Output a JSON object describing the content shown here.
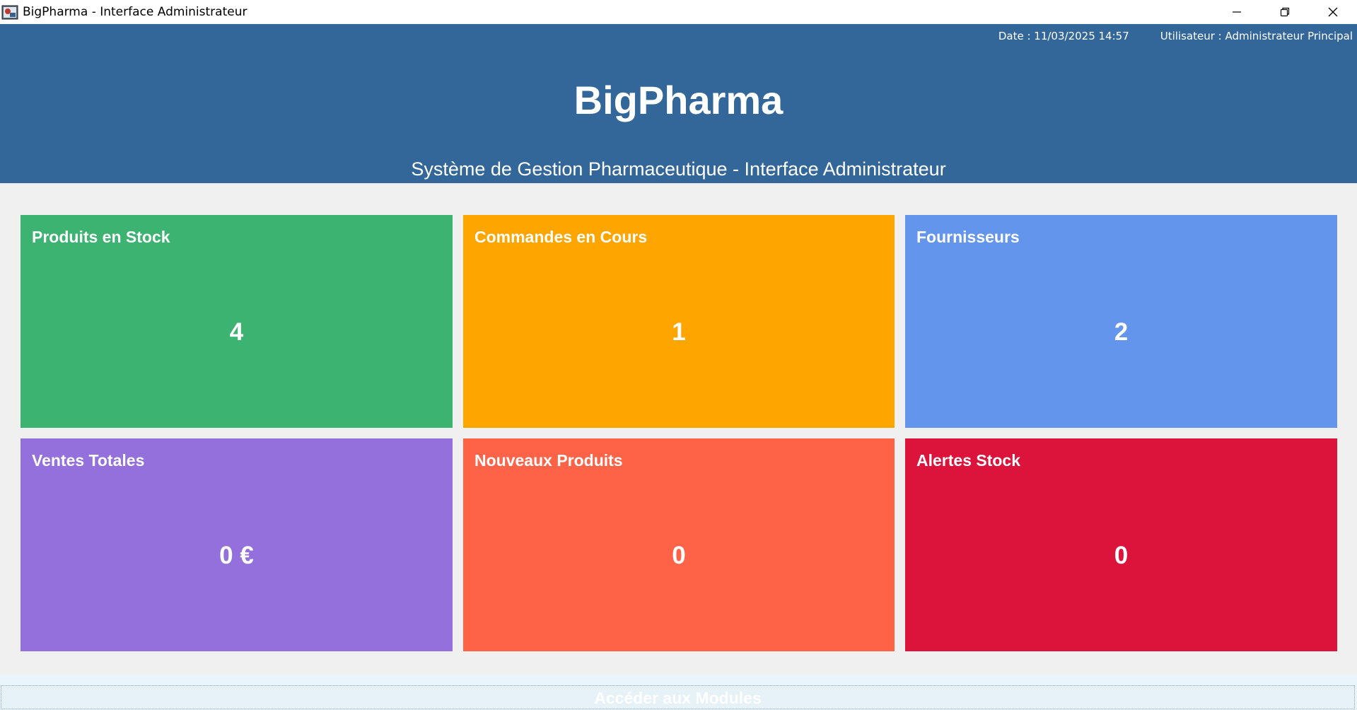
{
  "window": {
    "title": "BigPharma - Interface Administrateur"
  },
  "header": {
    "date": "Date : 11/03/2025 14:57",
    "user": "Utilisateur : Administrateur Principal",
    "app_title": "BigPharma",
    "subtitle": "Système de Gestion Pharmaceutique - Interface Administrateur",
    "background_color": "#336699"
  },
  "cards": [
    {
      "title": "Produits en Stock",
      "value": "4",
      "color": "#3cb371"
    },
    {
      "title": "Commandes en Cours",
      "value": "1",
      "color": "#ffa500"
    },
    {
      "title": "Fournisseurs",
      "value": "2",
      "color": "#6495ed"
    },
    {
      "title": "Ventes Totales",
      "value": "0 €",
      "color": "#9370db"
    },
    {
      "title": "Nouveaux Produits",
      "value": "0",
      "color": "#ff6347"
    },
    {
      "title": "Alertes Stock",
      "value": "0",
      "color": "#dc143c"
    }
  ],
  "footer": {
    "modules_button_label": "Accéder aux Modules"
  }
}
